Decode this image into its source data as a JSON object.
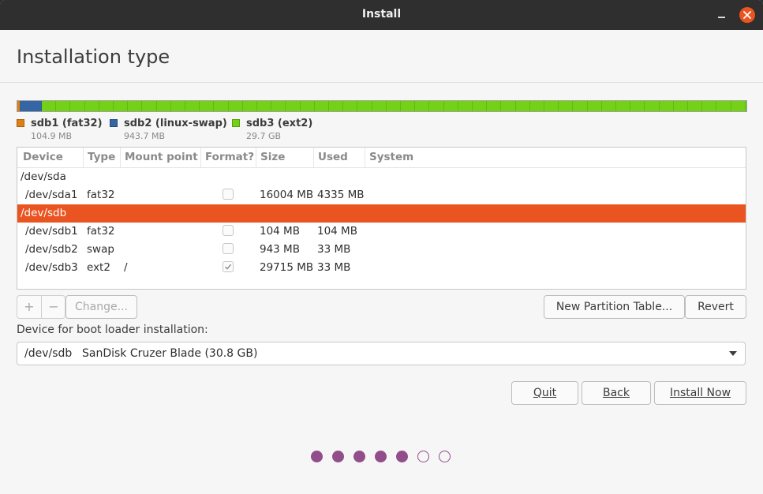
{
  "window": {
    "title": "Install"
  },
  "page": {
    "heading": "Installation type"
  },
  "colors": {
    "accent": "#e95420",
    "fat32": "#e07f14",
    "swap": "#3465a4",
    "ext2": "#73d216",
    "progress": "#924d8b"
  },
  "disk_bar": {
    "segments": [
      {
        "name": "sdb1",
        "fraction": 0.0034,
        "color": "#e07f14"
      },
      {
        "name": "sdb2",
        "fraction": 0.0306,
        "color": "#3465a4"
      },
      {
        "name": "sdb3",
        "fraction": 0.966,
        "color": "#73d216"
      }
    ]
  },
  "legend": [
    {
      "label": "sdb1 (fat32)",
      "size": "104.9 MB",
      "color": "#e07f14"
    },
    {
      "label": "sdb2 (linux-swap)",
      "size": "943.7 MB",
      "color": "#3465a4"
    },
    {
      "label": "sdb3 (ext2)",
      "size": "29.7 GB",
      "color": "#73d216"
    }
  ],
  "table": {
    "headers": [
      "Device",
      "Type",
      "Mount point",
      "Format?",
      "Size",
      "Used",
      "System"
    ],
    "rows": [
      {
        "device": "/dev/sda",
        "type": "",
        "mount": "",
        "format": null,
        "size": "",
        "used": "",
        "kind": "disk"
      },
      {
        "device": "/dev/sda1",
        "type": "fat32",
        "mount": "",
        "format": false,
        "size": "16004 MB",
        "used": "4335 MB",
        "kind": "part"
      },
      {
        "device": "/dev/sdb",
        "type": "",
        "mount": "",
        "format": null,
        "size": "",
        "used": "",
        "kind": "disk",
        "selected": true
      },
      {
        "device": "/dev/sdb1",
        "type": "fat32",
        "mount": "",
        "format": false,
        "size": "104 MB",
        "used": "104 MB",
        "kind": "part"
      },
      {
        "device": "/dev/sdb2",
        "type": "swap",
        "mount": "",
        "format": false,
        "size": "943 MB",
        "used": "33 MB",
        "kind": "part"
      },
      {
        "device": "/dev/sdb3",
        "type": "ext2",
        "mount": "/",
        "format": true,
        "size": "29715 MB",
        "used": "33 MB",
        "kind": "part"
      }
    ]
  },
  "partition_buttons": {
    "add": "+",
    "remove": "−",
    "change": "Change...",
    "new_table": "New Partition Table...",
    "revert": "Revert"
  },
  "boot_loader": {
    "label": "Device for boot loader installation:",
    "device": "/dev/sdb",
    "description": "SanDisk Cruzer Blade (30.8 GB)"
  },
  "actions": {
    "quit": "Quit",
    "back": "Back",
    "install_now": "Install Now"
  },
  "progress": {
    "total": 7,
    "completed": 5
  }
}
